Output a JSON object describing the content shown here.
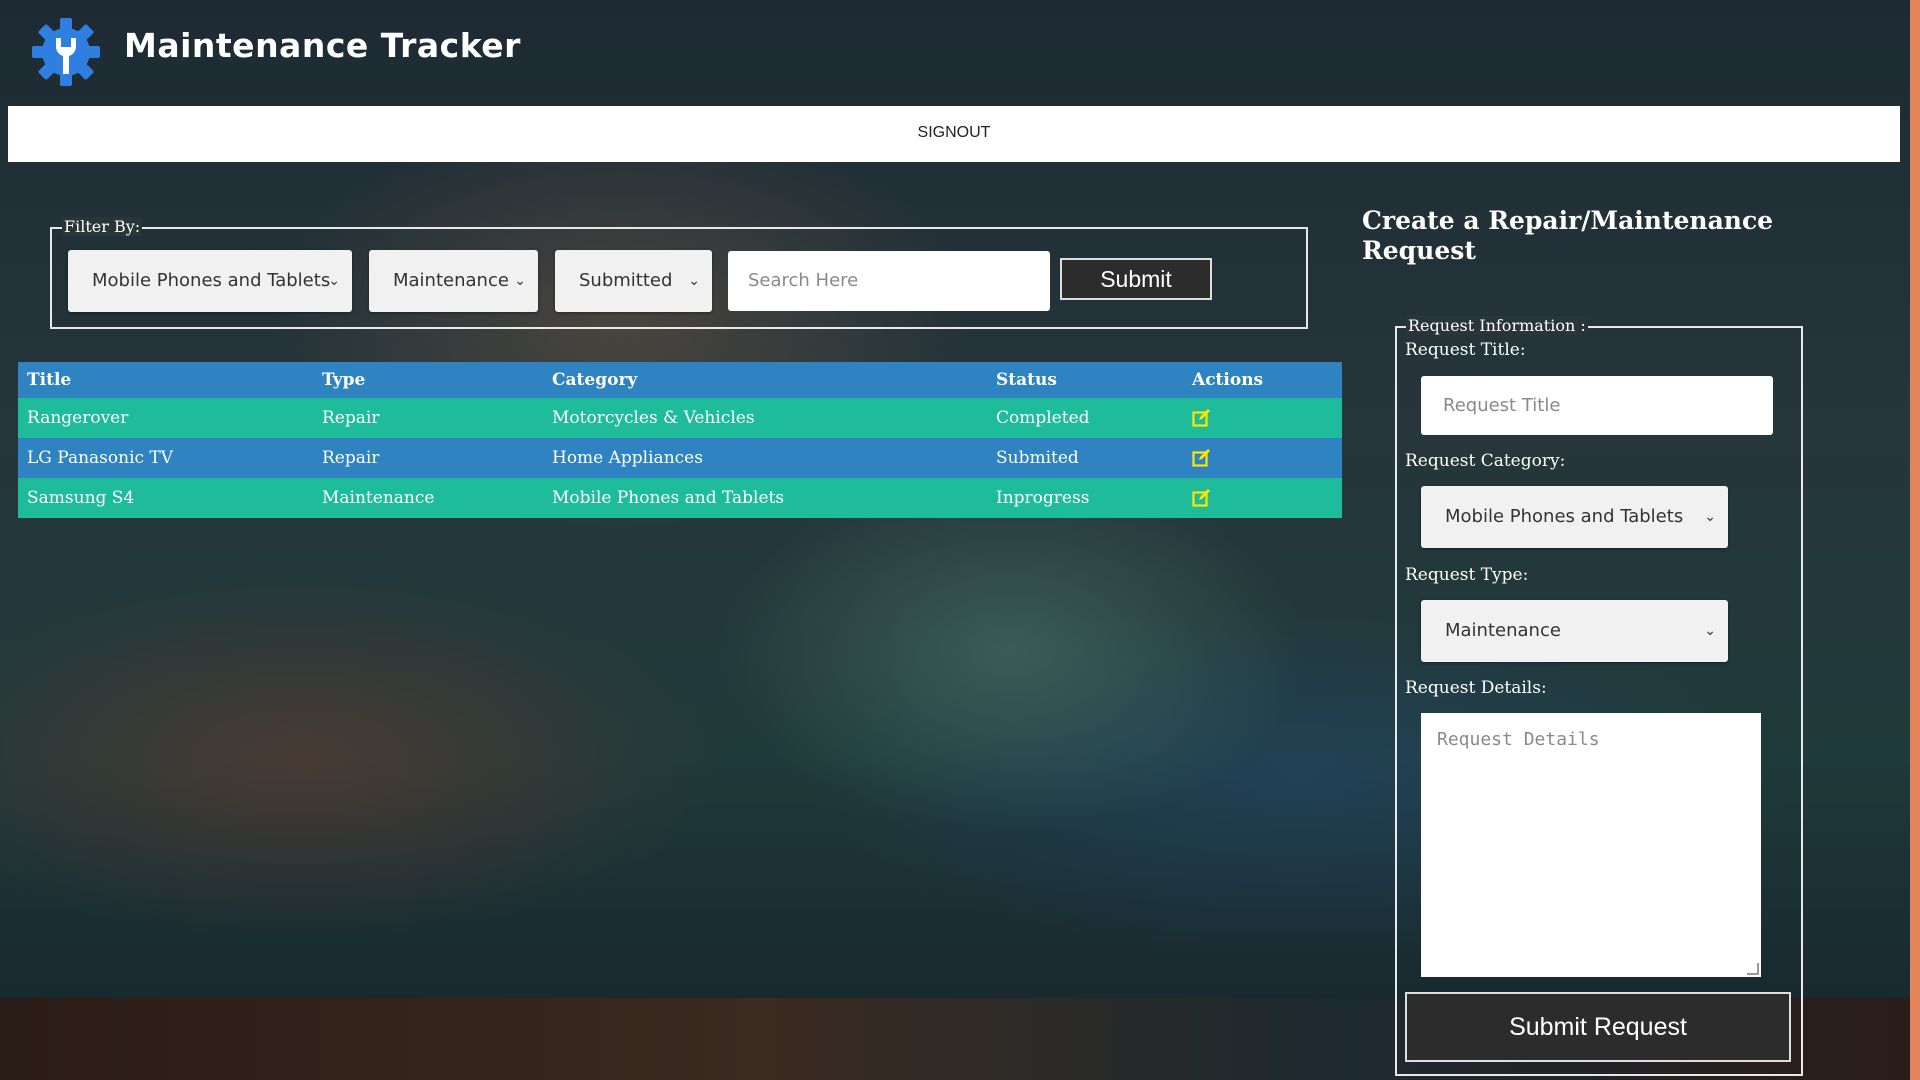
{
  "app": {
    "title": "Maintenance Tracker",
    "logo_icon": "gear-wrench-icon"
  },
  "nav": {
    "signout_label": "SIGNOUT"
  },
  "filter": {
    "legend": "Filter By:",
    "category_selected": "Mobile Phones and Tablets",
    "type_selected": "Maintenance",
    "status_selected": "Submitted",
    "search_placeholder": "Search Here",
    "submit_label": "Submit"
  },
  "table": {
    "headers": [
      "Title",
      "Type",
      "Category",
      "Status",
      "Actions"
    ],
    "rows": [
      {
        "title": "Rangerover",
        "type": "Repair",
        "category": "Motorcycles & Vehicles",
        "status": "Completed",
        "action_icon": "edit-icon"
      },
      {
        "title": "LG Panasonic TV",
        "type": "Repair",
        "category": "Home Appliances",
        "status": "Submited",
        "action_icon": "edit-icon"
      },
      {
        "title": "Samsung S4",
        "type": "Maintenance",
        "category": "Mobile Phones and Tablets",
        "status": "Inprogress",
        "action_icon": "edit-icon"
      }
    ],
    "colors": {
      "header": "#2e83c0",
      "row_green": "#1fbc9c",
      "row_blue": "#2e83c0",
      "edit_icon": "#ffe600"
    }
  },
  "form": {
    "title": "Create a Repair/Maintenance Request",
    "legend": "Request Information :",
    "title_label": "Request Title:",
    "title_placeholder": "Request Title",
    "category_label": "Request Category:",
    "category_selected": "Mobile Phones and Tablets",
    "type_label": "Request Type:",
    "type_selected": "Maintenance",
    "details_label": "Request Details:",
    "details_placeholder": "Request Details",
    "submit_label": "Submit Request"
  },
  "colors": {
    "accent_scrollbar": "#e4845a",
    "logo": "#2f7fe0"
  }
}
